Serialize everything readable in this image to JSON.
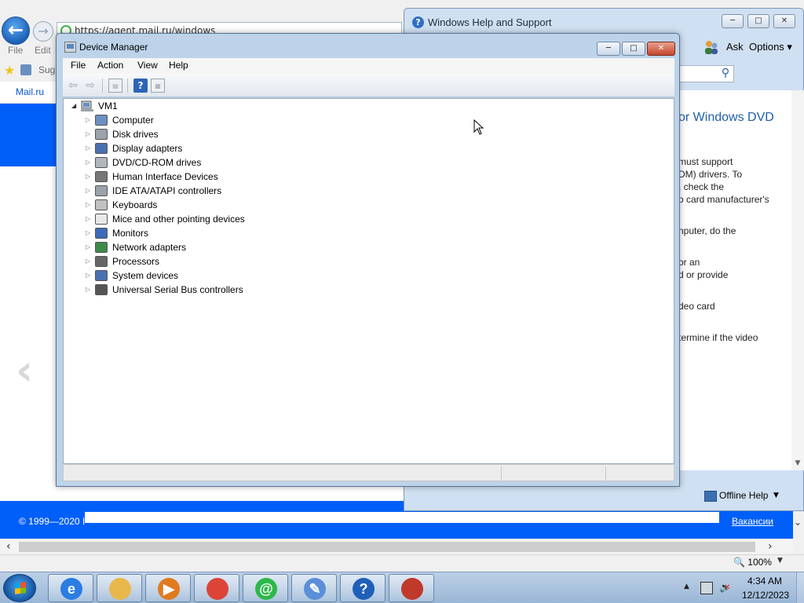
{
  "browser": {
    "address": "https://agent.mail.ru/windows",
    "menu": [
      "File",
      "Edit"
    ],
    "favorites_text": "Sug",
    "tab_link": "Mail.ru",
    "footer_text": "© 1999—2020 I",
    "footer_link": "Вакансии",
    "zoom": "100%"
  },
  "help_window": {
    "title": "Windows Help and Support",
    "ask": "Ask",
    "options": "Options",
    "heading": "or Windows DVD",
    "lines": [
      "must support",
      "DM) drivers. To",
      ", check the",
      "o card manufacturer's",
      "nputer, do the",
      "or an",
      "d or provide",
      "deo card",
      "termine if the video"
    ],
    "offline_help": "Offline Help"
  },
  "device_manager": {
    "title": "Device Manager",
    "menu": [
      "File",
      "Action",
      "View",
      "Help"
    ],
    "root": "VM1",
    "categories": [
      {
        "label": "Computer",
        "icon": "computer-icon"
      },
      {
        "label": "Disk drives",
        "icon": "disk-drive-icon"
      },
      {
        "label": "Display adapters",
        "icon": "display-adapter-icon"
      },
      {
        "label": "DVD/CD-ROM drives",
        "icon": "dvd-drive-icon"
      },
      {
        "label": "Human Interface Devices",
        "icon": "hid-icon"
      },
      {
        "label": "IDE ATA/ATAPI controllers",
        "icon": "ide-controller-icon"
      },
      {
        "label": "Keyboards",
        "icon": "keyboard-icon"
      },
      {
        "label": "Mice and other pointing devices",
        "icon": "mouse-icon"
      },
      {
        "label": "Monitors",
        "icon": "monitor-icon"
      },
      {
        "label": "Network adapters",
        "icon": "network-adapter-icon"
      },
      {
        "label": "Processors",
        "icon": "processor-icon"
      },
      {
        "label": "System devices",
        "icon": "system-devices-icon"
      },
      {
        "label": "Universal Serial Bus controllers",
        "icon": "usb-icon"
      }
    ]
  },
  "taskbar": {
    "pinned": [
      {
        "name": "internet-explorer",
        "glyph": "e",
        "color": "#2a7de1"
      },
      {
        "name": "windows-explorer",
        "glyph": "",
        "color": "#e8b84a"
      },
      {
        "name": "media-player",
        "glyph": "▶",
        "color": "#e07a20"
      },
      {
        "name": "chrome",
        "glyph": "",
        "color": "#db4437"
      },
      {
        "name": "mail-agent",
        "glyph": "@",
        "color": "#2db84a"
      },
      {
        "name": "setup-tool",
        "glyph": "✎",
        "color": "#5b8fd8"
      },
      {
        "name": "help-support",
        "glyph": "?",
        "color": "#1f5fb8"
      },
      {
        "name": "device-manager-toolbox",
        "glyph": "",
        "color": "#c0392b"
      }
    ],
    "time": "4:34 AM",
    "date": "12/12/2023"
  }
}
